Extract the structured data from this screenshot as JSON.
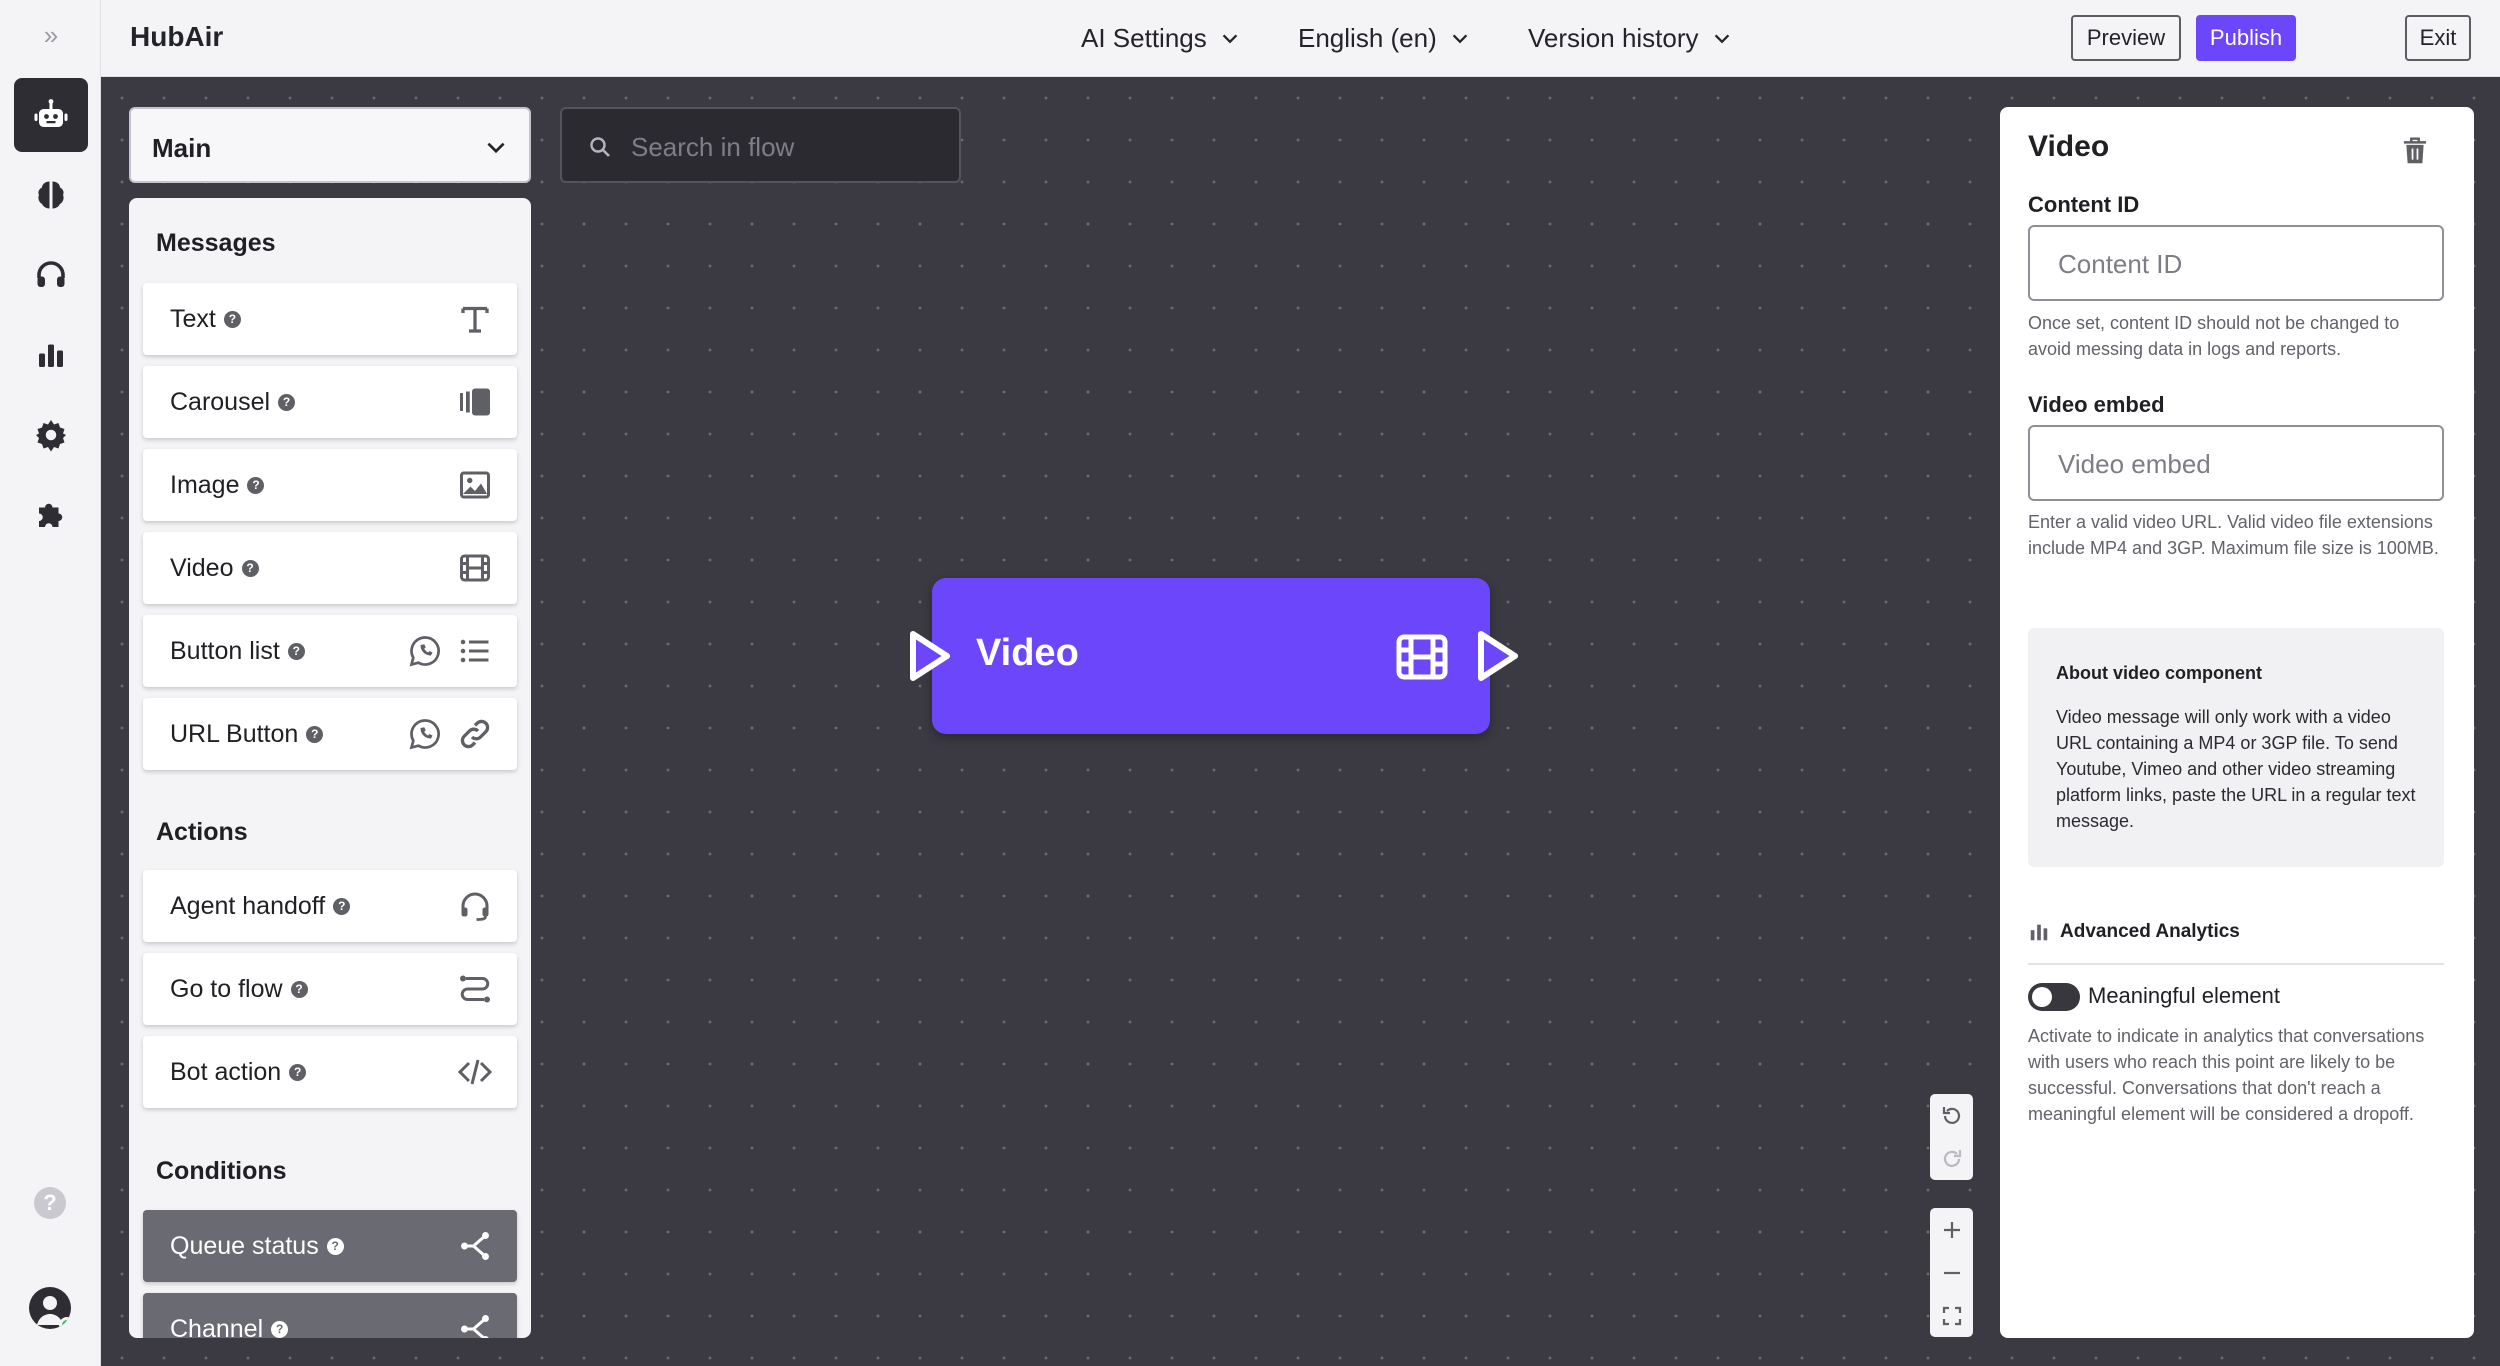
{
  "rail": {
    "expand_label": "»",
    "help_label": "?"
  },
  "topbar": {
    "brand": "HubAir",
    "menus": [
      {
        "label": "AI Settings"
      },
      {
        "label": "English (en)"
      },
      {
        "label": "Version history"
      }
    ],
    "preview_label": "Preview",
    "publish_label": "Publish",
    "exit_label": "Exit"
  },
  "flow_select": {
    "value": "Main"
  },
  "search": {
    "placeholder": "Search in flow"
  },
  "palette": {
    "messages_title": "Messages",
    "messages": [
      {
        "label": "Text",
        "icon": "text-icon"
      },
      {
        "label": "Carousel",
        "icon": "carousel-icon"
      },
      {
        "label": "Image",
        "icon": "image-icon"
      },
      {
        "label": "Video",
        "icon": "film-icon"
      },
      {
        "label": "Button list",
        "icon": "whatsapp-icon,list-icon"
      },
      {
        "label": "URL Button",
        "icon": "whatsapp-icon,link-icon"
      }
    ],
    "actions_title": "Actions",
    "actions": [
      {
        "label": "Agent handoff",
        "icon": "headset-icon"
      },
      {
        "label": "Go to flow",
        "icon": "route-icon"
      },
      {
        "label": "Bot action",
        "icon": "code-icon"
      }
    ],
    "conditions_title": "Conditions",
    "conditions": [
      {
        "label": "Queue status",
        "icon": "branch-icon"
      },
      {
        "label": "Channel",
        "icon": "branch-icon"
      }
    ]
  },
  "node": {
    "title": "Video"
  },
  "props": {
    "title": "Video",
    "content_id_label": "Content ID",
    "content_id_placeholder": "Content ID",
    "content_id_hint": "Once set, content ID should not be changed to avoid messing data in logs and reports.",
    "video_embed_label": "Video embed",
    "video_embed_placeholder": "Video embed",
    "video_embed_hint": "Enter a valid video URL. Valid video file extensions include MP4 and 3GP. Maximum file size is 100MB.",
    "about_title": "About video component",
    "about_text": "Video message will only work with a video URL containing a MP4 or 3GP file. To send Youtube, Vimeo and other video streaming platform links, paste the URL in a regular text message.",
    "analytics_title": "Advanced Analytics",
    "meaningful_label": "Meaningful element",
    "meaningful_on": false,
    "meaningful_hint": "Activate to indicate in analytics that conversations with users who reach this point are likely to be successful. Conversations that don't reach a meaningful element will be considered a dropoff."
  },
  "colors": {
    "accent": "#6b46fb",
    "canvas": "#3b3a42",
    "panel": "#f4f4f6"
  }
}
